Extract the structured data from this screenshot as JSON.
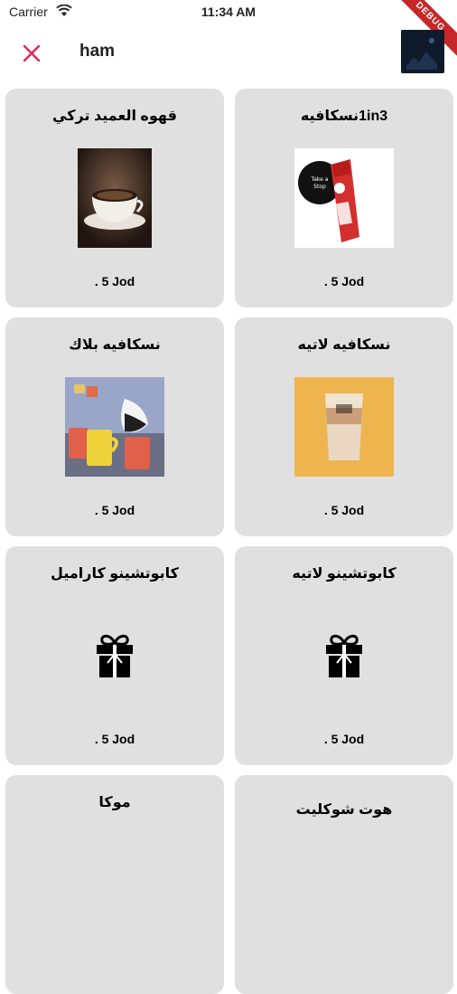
{
  "status_bar": {
    "carrier": "Carrier",
    "time": "11:34 AM"
  },
  "debug_label": "DEBUG",
  "header": {
    "search_text": "ham"
  },
  "products": [
    {
      "title": "قهوه العميد تركي",
      "price": ". 5 Jod",
      "image": "turkish-coffee-cup-image"
    },
    {
      "title": "1in3نسكافيه",
      "price": ". 5 Jod",
      "image": "nescafe-stick-image"
    },
    {
      "title": "نسكافيه بلاك",
      "price": ". 5 Jod",
      "image": "coffee-mugs-illustration-image"
    },
    {
      "title": "نسكافيه لاتيه",
      "price": ". 5 Jod",
      "image": "latte-cup-image"
    },
    {
      "title": "كابوتشينو كاراميل",
      "price": ". 5 Jod",
      "image": "gift-icon"
    },
    {
      "title": "كابوتشينو لاتيه",
      "price": ". 5 Jod",
      "image": "gift-icon"
    },
    {
      "title": "موكا",
      "price": "",
      "image": ""
    },
    {
      "title": "هوت شوكليت",
      "price": "",
      "image": ""
    }
  ]
}
